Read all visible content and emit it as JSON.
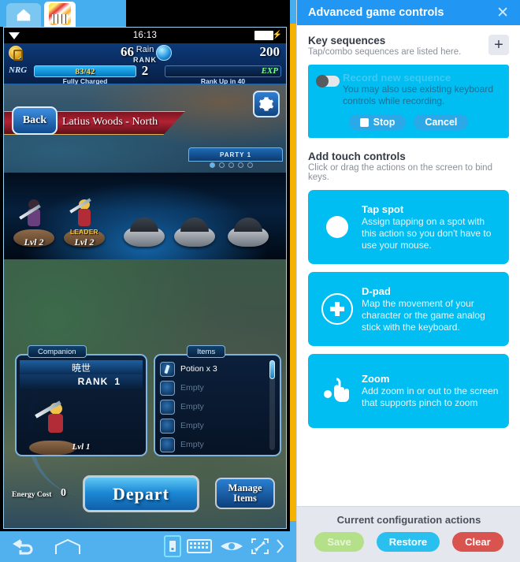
{
  "emulator": {
    "tabs": [
      {
        "name": "home-tab",
        "icon": "home-icon"
      },
      {
        "name": "game-tab",
        "icon": "game-thumbnail-icon"
      }
    ],
    "status_bar": {
      "wifi_icon": "wifi-icon",
      "clock": "16:13",
      "battery_icon": "battery-icon",
      "charging_icon": "charging-bolt-icon"
    },
    "hud": {
      "gold_icon": "coin-icon",
      "gold": "66",
      "gem_icon": "gem-icon",
      "gems": "200",
      "player_name": "Rain",
      "rank_label": "RANK",
      "rank_value": "2",
      "nrg_label": "NRG",
      "nrg_value": "83/42",
      "nrg_sub": "Fully Charged",
      "exp_label": "EXP",
      "exp_sub": "Rank Up in 40"
    },
    "map": {
      "back_button": "Back",
      "location": "Latius Woods - North",
      "settings_icon": "gear-icon",
      "party_tab": "PARTY 1"
    },
    "party": [
      {
        "level": "Lvl 2",
        "leader": "",
        "empty": false
      },
      {
        "level": "Lvl 2",
        "leader": "LEADER",
        "empty": false
      },
      {
        "level": "",
        "leader": "",
        "empty": true
      },
      {
        "level": "",
        "leader": "",
        "empty": true
      },
      {
        "level": "",
        "leader": "",
        "empty": true
      }
    ],
    "companion_panel": {
      "tab_label": "Companion",
      "name": "暁世",
      "rank_label": "RANK",
      "rank_value": "1",
      "level": "Lvl 1"
    },
    "items_panel": {
      "tab_label": "Items",
      "rows": [
        {
          "label": "Potion x 3",
          "empty": false
        },
        {
          "label": "Empty",
          "empty": true
        },
        {
          "label": "Empty",
          "empty": true
        },
        {
          "label": "Empty",
          "empty": true
        },
        {
          "label": "Empty",
          "empty": true
        }
      ]
    },
    "actions": {
      "energy_cost_label": "Energy Cost",
      "energy_cost_value": "0",
      "depart_label": "Depart",
      "manage_items_label": "Manage Items"
    },
    "bottom_bar": [
      {
        "name": "back-arrow-icon"
      },
      {
        "name": "home-pentagon-icon"
      },
      {
        "name": "phone-rotate-icon"
      },
      {
        "name": "keyboard-icon"
      },
      {
        "name": "eye-icon"
      },
      {
        "name": "fullscreen-icon"
      },
      {
        "name": "chevron-right-icon"
      }
    ]
  },
  "panel": {
    "title": "Advanced game controls",
    "close_icon": "close-icon",
    "key_sequences": {
      "title": "Key sequences",
      "subtitle": "Tap/combo sequences are listed here.",
      "add_icon": "plus-icon",
      "record": {
        "title": "Record new sequence",
        "toggle_icon": "toggle-switch-icon",
        "description": "You may also use existing keyboard controls while recording.",
        "stop_label": "Stop",
        "stop_icon": "stop-square-icon",
        "cancel_label": "Cancel"
      }
    },
    "touch_controls": {
      "title": "Add touch controls",
      "subtitle": "Click or drag the actions on the screen to bind keys.",
      "cards": [
        {
          "icon": "tap-spot-circle-icon",
          "title": "Tap spot",
          "description": "Assign tapping on a spot with this action so you don't have to use your mouse."
        },
        {
          "icon": "dpad-icon",
          "title": "D-pad",
          "description": "Map the movement of your character or the game analog stick with the keyboard."
        },
        {
          "icon": "pinch-zoom-hand-icon",
          "title": "Zoom",
          "description": "Add zoom in or out to the screen that supports pinch to zoom"
        }
      ]
    },
    "footer": {
      "title": "Current configuration actions",
      "save_label": "Save",
      "restore_label": "Restore",
      "clear_label": "Clear"
    }
  },
  "colors": {
    "accent_blue": "#2196f3",
    "card_cyan": "#00bdf2",
    "divider_yellow": "#f5b301",
    "save_green": "#b5e08a",
    "restore_cyan": "#29c0f0",
    "clear_red": "#d9534f"
  }
}
